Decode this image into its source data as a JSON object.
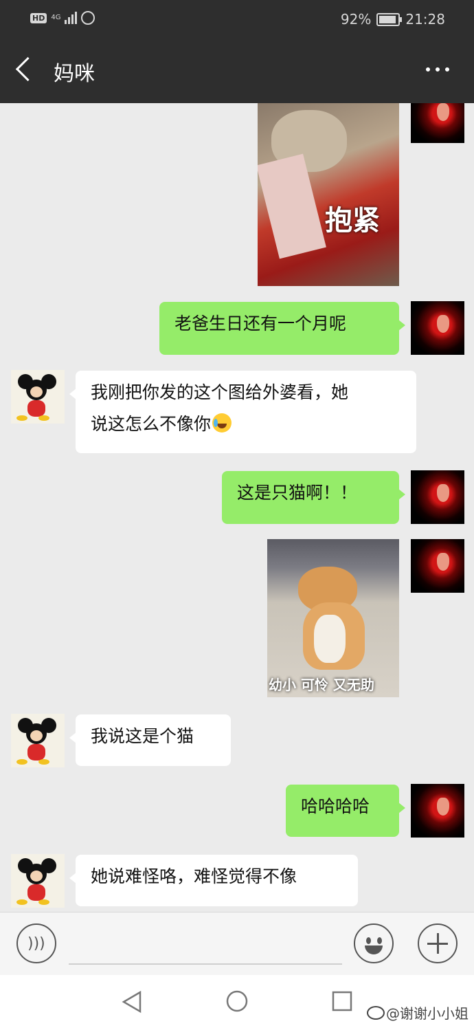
{
  "status_bar": {
    "hd_label": "HD",
    "network": "4G",
    "battery": "92%",
    "battery_level": 0.92,
    "time": "21:28"
  },
  "header": {
    "title": "妈咪",
    "icons": [
      "back-icon",
      "more-icon"
    ]
  },
  "messages": [
    {
      "sender": "me",
      "type": "sticker",
      "caption": "抱紧"
    },
    {
      "sender": "me",
      "type": "text",
      "text": "老爸生日还有一个月呢"
    },
    {
      "sender": "mom",
      "type": "text",
      "text_line1": "我刚把你发的这个图给外婆看，她",
      "text_line2": "说这怎么不像你",
      "emoji": "crying-laughing-emoji"
    },
    {
      "sender": "me",
      "type": "text",
      "text": "这是只猫啊！！"
    },
    {
      "sender": "me",
      "type": "sticker",
      "caption": "幼小 可怜 又无助"
    },
    {
      "sender": "mom",
      "type": "text",
      "text": "我说这是个猫"
    },
    {
      "sender": "me",
      "type": "text",
      "text": "哈哈哈哈"
    },
    {
      "sender": "mom",
      "type": "text",
      "text": "她说难怪咯，难怪觉得不像"
    }
  ],
  "input_bar": {
    "icons": [
      "voice-icon",
      "emoji-icon",
      "plus-icon"
    ]
  },
  "nav_bar": {
    "icons": [
      "nav-back-icon",
      "nav-home-icon",
      "nav-recent-icon"
    ]
  },
  "watermark": "@谢谢小小姐",
  "colors": {
    "header_bg": "#2e2e2e",
    "my_bubble": "#95ec69",
    "their_bubble": "#ffffff",
    "chat_bg": "#ebebeb"
  }
}
